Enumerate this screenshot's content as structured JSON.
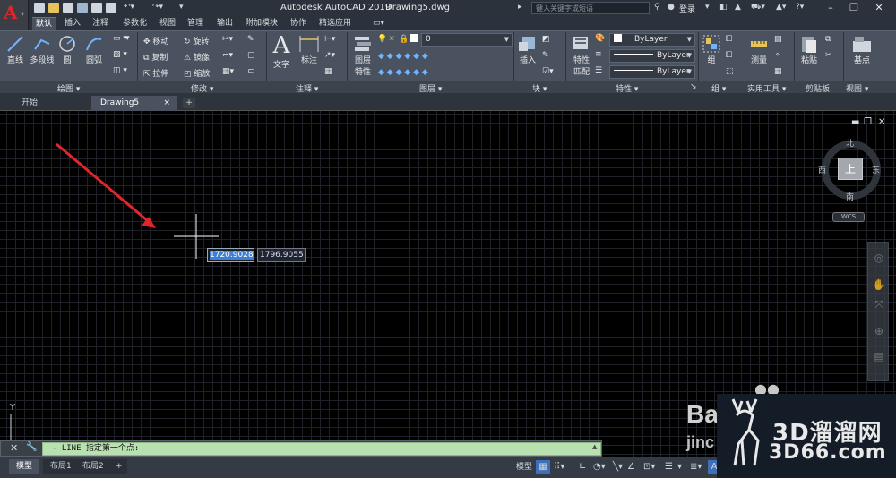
{
  "titlebar": {
    "app_title": "Autodesk AutoCAD 2019",
    "doc_title": "Drawing5.dwg",
    "search_placeholder": "键入关键字或短语",
    "login_label": "登录"
  },
  "ribbon_tabs": [
    "默认",
    "插入",
    "注释",
    "参数化",
    "视图",
    "管理",
    "输出",
    "附加模块",
    "协作",
    "精选应用"
  ],
  "ribbon": {
    "draw": {
      "line": "直线",
      "polyline": "多段线",
      "circle": "圆",
      "arc": "圆弧",
      "title": "绘图"
    },
    "modify": {
      "move": "移动",
      "rotate": "旋转",
      "copy": "复制",
      "mirror": "镜像",
      "stretch": "拉伸",
      "scale": "缩放",
      "title": "修改"
    },
    "annotation": {
      "text": "文字",
      "dimension": "标注",
      "title": "注释"
    },
    "layers": {
      "layer_props_1": "图层",
      "layer_props_2": "特性",
      "current_layer": "0",
      "title": "图层"
    },
    "block": {
      "insert": "插入",
      "title": "块"
    },
    "properties": {
      "match_1": "特性",
      "match_2": "匹配",
      "color": "ByLayer",
      "linetype": "ByLayer",
      "lineweight": "ByLayer",
      "title": "特性"
    },
    "groups": {
      "group": "组",
      "title": "组"
    },
    "utilities": {
      "measure": "测量",
      "title": "实用工具"
    },
    "clipboard": {
      "paste": "粘贴",
      "title": "剪贴板"
    },
    "view": {
      "base": "基点",
      "title": "视图"
    }
  },
  "file_tabs": {
    "start": "开始",
    "drawing": "Drawing5"
  },
  "dynamic_input": {
    "x": "1720.9028",
    "y": "1796.9055"
  },
  "viewcube": {
    "north": "北",
    "south": "南",
    "east": "东",
    "west": "西",
    "face": "上",
    "wcs": "WCS"
  },
  "ucs": {
    "y_label": "Y"
  },
  "command_line": {
    "text": "- LINE 指定第一个点:"
  },
  "layout_tabs": [
    "模型",
    "布局1",
    "布局2"
  ],
  "status": {
    "model_label": "模型"
  },
  "watermark": {
    "brand_cn": "3D溜溜网",
    "brand_url": "3D66.com",
    "baidu_1": "Ba",
    "baidu_2": "jinc"
  },
  "colors": {
    "accent": "#e0262c",
    "cmdline": "#b9e0b0",
    "canvas": "#000000",
    "ribbon": "#4a5260"
  }
}
